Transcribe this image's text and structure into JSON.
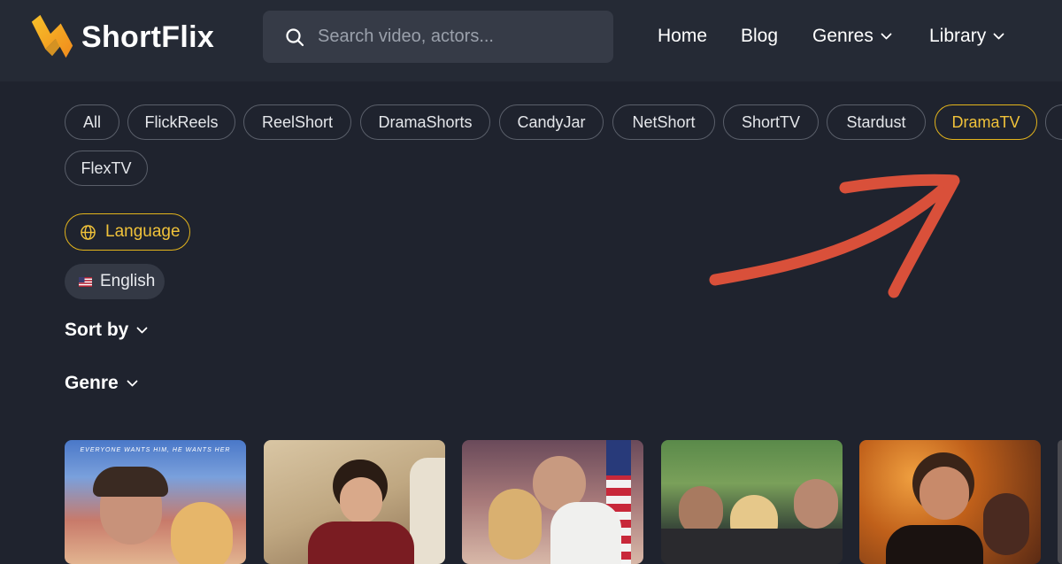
{
  "header": {
    "brand": "ShortFlix",
    "search_placeholder": "Search video, actors...",
    "nav": [
      {
        "label": "Home",
        "has_dropdown": false
      },
      {
        "label": "Blog",
        "has_dropdown": false
      },
      {
        "label": "Genres",
        "has_dropdown": true
      },
      {
        "label": "Library",
        "has_dropdown": true
      }
    ]
  },
  "filters": {
    "platforms": [
      "All",
      "FlickReels",
      "ReelShort",
      "DramaShorts",
      "CandyJar",
      "NetShort",
      "ShortTV",
      "Stardust",
      "DramaTV",
      "FlexTV"
    ],
    "active_platform": "DramaTV",
    "language_label": "Language",
    "language_selected": "English",
    "sort_label": "Sort by",
    "genre_label": "Genre"
  },
  "posters": [
    {
      "tagline": "EVERYONE WANTS HIM, HE WANTS HER"
    },
    {
      "tagline": ""
    },
    {
      "tagline": ""
    },
    {
      "tagline": ""
    },
    {
      "tagline": ""
    }
  ],
  "colors": {
    "background": "#1f232e",
    "header": "#252a35",
    "accent": "#e3b41c",
    "annotation_arrow": "#d9503a"
  },
  "icons": {
    "search": "search-icon",
    "chevron": "chevron-down-icon",
    "globe": "globe-icon",
    "flag": "us-flag-icon"
  }
}
